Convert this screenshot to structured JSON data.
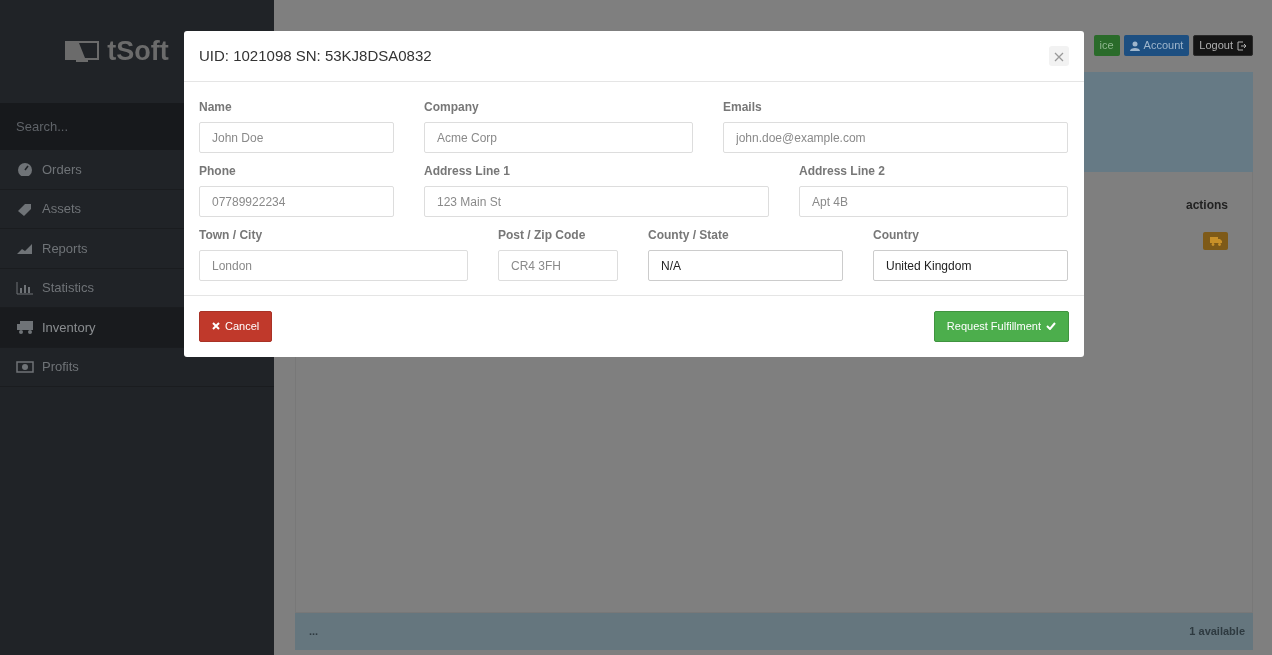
{
  "sidebar": {
    "logo": "tSoft",
    "search": {
      "placeholder": "Search..."
    },
    "items": [
      {
        "label": "Orders",
        "kind": "gauge",
        "selected": false
      },
      {
        "label": "Assets",
        "kind": "tag",
        "selected": false
      },
      {
        "label": "Reports",
        "kind": "area",
        "selected": false
      },
      {
        "label": "Statistics",
        "kind": "bars",
        "selected": false
      },
      {
        "label": "Inventory",
        "kind": "truck",
        "selected": true
      },
      {
        "label": "Profits",
        "kind": "money",
        "selected": false
      }
    ]
  },
  "header": {
    "buttons": [
      {
        "label": "ice",
        "kind": "success"
      },
      {
        "label": "Account",
        "kind": "primary"
      },
      {
        "label": "Logout",
        "kind": "dark"
      }
    ]
  },
  "table": {
    "columns": [
      "actions"
    ]
  },
  "footer": {
    "left": "...",
    "right": "1 available"
  },
  "modal": {
    "title": "UID: 1021098 SN: 53KJ8DSA0832",
    "rows": [
      [
        {
          "label": "Name",
          "kind": "input",
          "placeholder": "John Doe"
        },
        {
          "label": "Company",
          "kind": "input",
          "placeholder": "Acme Corp"
        },
        {
          "label": "Emails",
          "kind": "input",
          "placeholder": "john.doe@example.com"
        }
      ],
      [
        {
          "label": "Phone",
          "kind": "input",
          "placeholder": "07789922234"
        },
        {
          "label": "Address Line 1",
          "kind": "input",
          "placeholder": "123 Main St"
        },
        {
          "label": "Address Line 2",
          "kind": "input",
          "placeholder": "Apt 4B"
        }
      ],
      [
        {
          "label": "Town / City",
          "kind": "input",
          "placeholder": "London"
        },
        {
          "label": "Post / Zip Code",
          "kind": "input",
          "placeholder": "CR4 3FH"
        },
        {
          "label": "County / State",
          "kind": "select",
          "value": "N/A"
        },
        {
          "label": "Country",
          "kind": "select",
          "value": "United Kingdom"
        }
      ]
    ],
    "buttons": [
      {
        "label": "Cancel",
        "kind": "cancel"
      },
      {
        "label": "Request Fulfillment",
        "kind": "confirm"
      }
    ]
  }
}
